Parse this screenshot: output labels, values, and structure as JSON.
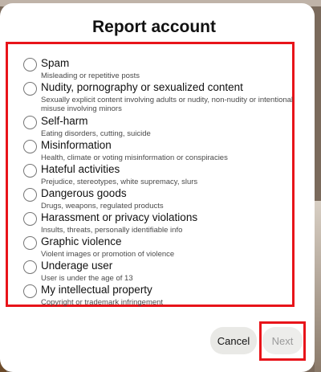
{
  "modal": {
    "title": "Report account"
  },
  "options": [
    {
      "label": "Spam",
      "description": "Misleading or repetitive posts"
    },
    {
      "label": "Nudity, pornography or sexualized content",
      "description": "Sexually explicit content involving adults or nudity, non-nudity or intentional misuse involving minors"
    },
    {
      "label": "Self-harm",
      "description": "Eating disorders, cutting, suicide"
    },
    {
      "label": "Misinformation",
      "description": "Health, climate or voting misinformation or conspiracies"
    },
    {
      "label": "Hateful activities",
      "description": "Prejudice, stereotypes, white supremacy, slurs"
    },
    {
      "label": "Dangerous goods",
      "description": "Drugs, weapons, regulated products"
    },
    {
      "label": "Harassment or privacy violations",
      "description": "Insults, threats, personally identifiable info"
    },
    {
      "label": "Graphic violence",
      "description": "Violent images or promotion of violence"
    },
    {
      "label": "Underage user",
      "description": "User is under the age of 13"
    },
    {
      "label": "My intellectual property",
      "description": "Copyright or trademark infringement"
    }
  ],
  "buttons": {
    "cancel": "Cancel",
    "next": "Next"
  },
  "colors": {
    "highlight": "#e8141a",
    "cancel_bg": "#e9e9e6",
    "next_bg": "#ededeb",
    "next_text": "#9a9a9a"
  }
}
